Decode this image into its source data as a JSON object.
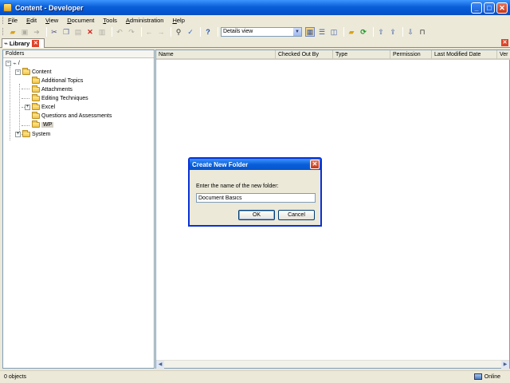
{
  "window": {
    "title": "Content - Developer",
    "minimize": "_",
    "maximize": "□",
    "close": "✕"
  },
  "menu": [
    "File",
    "Edit",
    "View",
    "Document",
    "Tools",
    "Administration",
    "Help"
  ],
  "toolbar": {
    "view_select": "Details view"
  },
  "tab": {
    "label": "Library"
  },
  "folders_pane": {
    "header": "Folders",
    "tree": {
      "root": "/",
      "content": "Content",
      "children": [
        "Additional Topics",
        "Attachments",
        "Editing Techniques",
        "Excel",
        "Questions and Assessments",
        "WP"
      ],
      "system": "System"
    }
  },
  "list_pane": {
    "columns": [
      "Name",
      "Checked Out By",
      "Type",
      "Permission",
      "Last Modified Date",
      "Ver"
    ]
  },
  "status": {
    "left": "0 objects",
    "right": "Online"
  },
  "dialog": {
    "title": "Create New Folder",
    "prompt": "Enter the name of the new folder:",
    "input_value": "Document Basics",
    "ok": "OK",
    "cancel": "Cancel"
  }
}
